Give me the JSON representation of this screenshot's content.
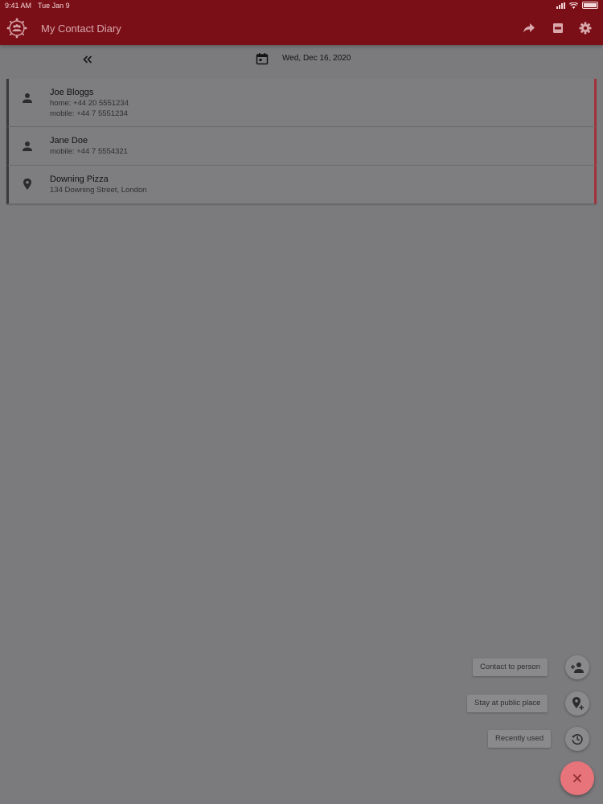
{
  "status_bar": {
    "time": "9:41 AM",
    "date": "Tue Jan 9"
  },
  "app_bar": {
    "title": "My Contact Diary",
    "actions": [
      "share-icon",
      "pdf-icon",
      "gear-icon"
    ]
  },
  "date_nav": {
    "date": "Wed, Dec 16, 2020"
  },
  "entries": [
    {
      "type": "person",
      "title": "Joe Bloggs",
      "lines": [
        "home: +44 20 5551234",
        "mobile: +44 7 5551234"
      ]
    },
    {
      "type": "person",
      "title": "Jane Doe",
      "lines": [
        "mobile: +44 7 5554321"
      ]
    },
    {
      "type": "place",
      "title": "Downing Pizza",
      "lines": [
        "134 Downing Street, London"
      ]
    }
  ],
  "speed_dial": {
    "items": [
      {
        "label": "Contact to person",
        "icon": "add-person-icon"
      },
      {
        "label": "Stay at public place",
        "icon": "add-location-icon"
      },
      {
        "label": "Recently used",
        "icon": "history-icon"
      }
    ],
    "close_icon": "close-icon"
  },
  "colors": {
    "app_bar": "#7b0f17",
    "scrim_background": "#7b7a7d",
    "fab": "#e8747b",
    "entry_accent": "#a2333b"
  }
}
